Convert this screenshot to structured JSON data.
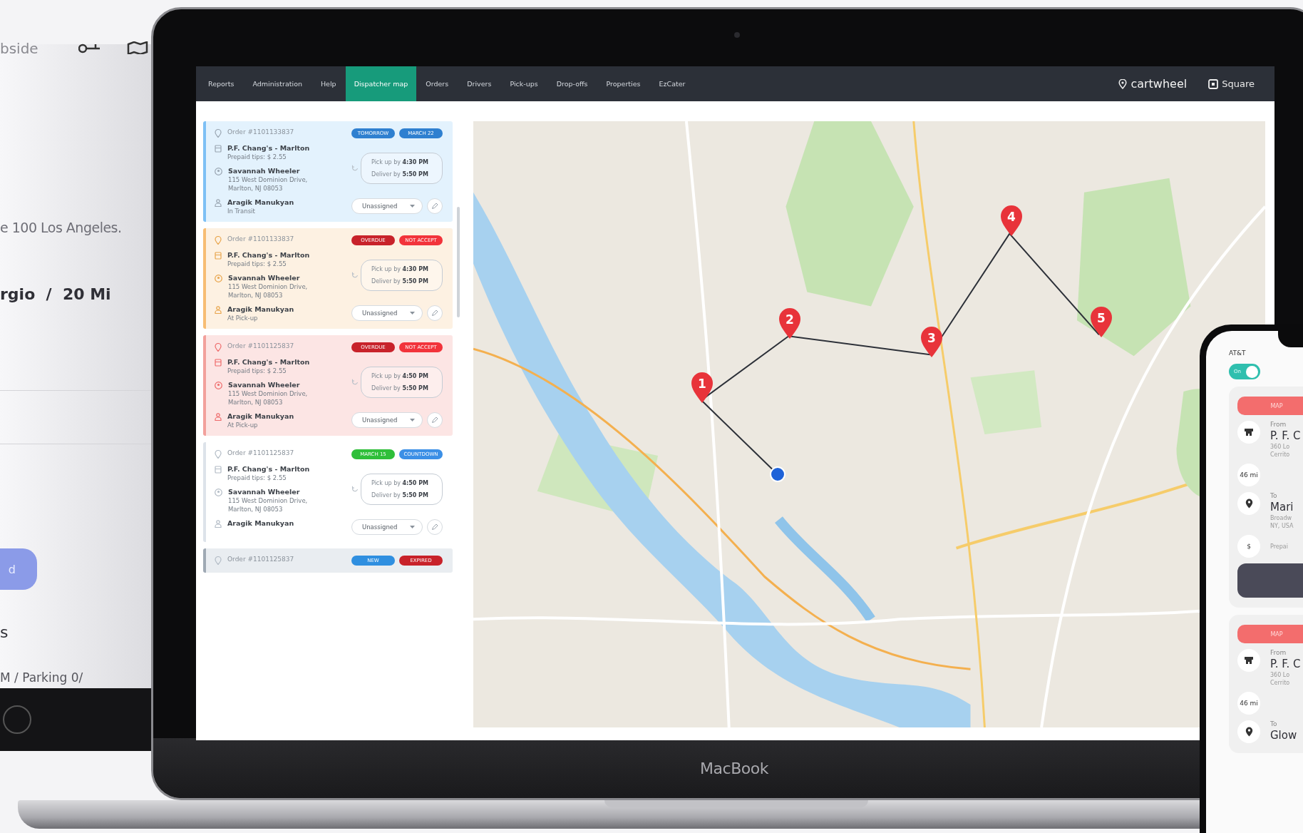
{
  "background_app": {
    "top_label": "bside",
    "address": "e 100 Los Angeles.",
    "route": "rgio  /  20 Mi",
    "button": "d",
    "section": "s",
    "footer": "M / Parking 0/"
  },
  "laptop": {
    "brand": "MacBook"
  },
  "nav": {
    "items": [
      {
        "label": "Reports",
        "selected": false
      },
      {
        "label": "Administration",
        "selected": false
      },
      {
        "label": "Help",
        "selected": false
      },
      {
        "label": "Dispatcher map",
        "selected": true
      },
      {
        "label": "Orders",
        "selected": false
      },
      {
        "label": "Drivers",
        "selected": false
      },
      {
        "label": "Pick-ups",
        "selected": false
      },
      {
        "label": "Drop-offs",
        "selected": false
      },
      {
        "label": "Properties",
        "selected": false
      },
      {
        "label": "EzCater",
        "selected": false
      }
    ],
    "logo": "cartwheel",
    "account": "Square"
  },
  "orders": [
    {
      "kind": "info",
      "order": "Order #1101133837",
      "badges": [
        {
          "text": "TOMORROW",
          "color": "#2f80d0"
        },
        {
          "text": "MARCH 22",
          "color": "#2f80d0"
        }
      ],
      "restaurant": "P.F. Chang's - Marlton",
      "tips": "Prepaid tips: $ 2.55",
      "customer": "Savannah Wheeler",
      "address": [
        "115 West Dominion Drive,",
        "Marlton, NJ 08053"
      ],
      "driver": "Aragik Manukyan",
      "status": "In Transit",
      "pickup_label": "Pick up by",
      "pickup_time": "4:30 PM",
      "deliver_label": "Deliver by",
      "deliver_time": "5:50 PM",
      "assign": "Unassigned"
    },
    {
      "kind": "warning",
      "order": "Order #1101133837",
      "badges": [
        {
          "text": "OVERDUE",
          "color": "#c8222a"
        },
        {
          "text": "NOT ACCEPT",
          "color": "#f2333b"
        }
      ],
      "restaurant": "P.F. Chang's - Marlton",
      "tips": "Prepaid tips: $ 2.55",
      "customer": "Savannah Wheeler",
      "address": [
        "115 West Dominion Drive,",
        "Marlton, NJ 08053"
      ],
      "driver": "Aragik Manukyan",
      "status": "At Pick-up",
      "pickup_label": "Pick up by",
      "pickup_time": "4:30 PM",
      "deliver_label": "Deliver by",
      "deliver_time": "5:50 PM",
      "assign": "Unassigned"
    },
    {
      "kind": "danger",
      "order": "Order #1101125837",
      "badges": [
        {
          "text": "OVERDUE",
          "color": "#c8222a"
        },
        {
          "text": "NOT ACCEPT",
          "color": "#f2333b"
        }
      ],
      "restaurant": "P.F. Chang's - Marlton",
      "tips": "Prepaid tips: $ 2.55",
      "customer": "Savannah Wheeler",
      "address": [
        "115 West Dominion Drive,",
        "Marlton, NJ 08053"
      ],
      "driver": "Aragik Manukyan",
      "status": "At Pick-up",
      "pickup_label": "Pick up by",
      "pickup_time": "4:50 PM",
      "deliver_label": "Deliver by",
      "deliver_time": "5:50 PM",
      "assign": "Unassigned"
    },
    {
      "kind": "plain",
      "order": "Order #1101125837",
      "badges": [
        {
          "text": "MARCH 15",
          "color": "#2fbf3a"
        },
        {
          "text": "COUNTDOWN",
          "color": "#3b8fe6"
        }
      ],
      "restaurant": "P.F. Chang's - Marlton",
      "tips": "Prepaid tips: $ 2.55",
      "customer": "Savannah Wheeler",
      "address": [
        "115 West Dominion Drive,",
        "Marlton, NJ 08053"
      ],
      "driver": "Aragik Manukyan",
      "pickup_label": "Pick up by",
      "pickup_time": "4:50 PM",
      "deliver_label": "Deliver by",
      "deliver_time": "5:50 PM",
      "assign": "Unassigned"
    },
    {
      "kind": "muted",
      "order": "Order #1101125837",
      "badges": [
        {
          "text": "NEW",
          "color": "#2f8fe0"
        },
        {
          "text": "EXPIRED",
          "color": "#c8222a"
        }
      ]
    }
  ],
  "map": {
    "kind": "picture",
    "stops": [
      "1",
      "2",
      "3",
      "4",
      "5"
    ]
  },
  "phone": {
    "carrier": "AT&T",
    "toggle": {
      "label": "On",
      "on": true
    },
    "cards": [
      {
        "button": "MAP",
        "from_label": "From",
        "from": "P. F. C",
        "from_address": [
          "360 Lo",
          "Cerrito"
        ],
        "distance": "46 mi",
        "to_label": "To",
        "to": "Mari",
        "to_address": [
          "Broadw",
          "NY, USA"
        ],
        "price_icon": "$",
        "payment": "Prepai"
      },
      {
        "button": "MAP",
        "from_label": "From",
        "from": "P. F. C",
        "from_address": [
          "360 Lo",
          "Cerrito"
        ],
        "distance": "46 mi",
        "to_label": "To",
        "to": "Glow"
      }
    ]
  }
}
